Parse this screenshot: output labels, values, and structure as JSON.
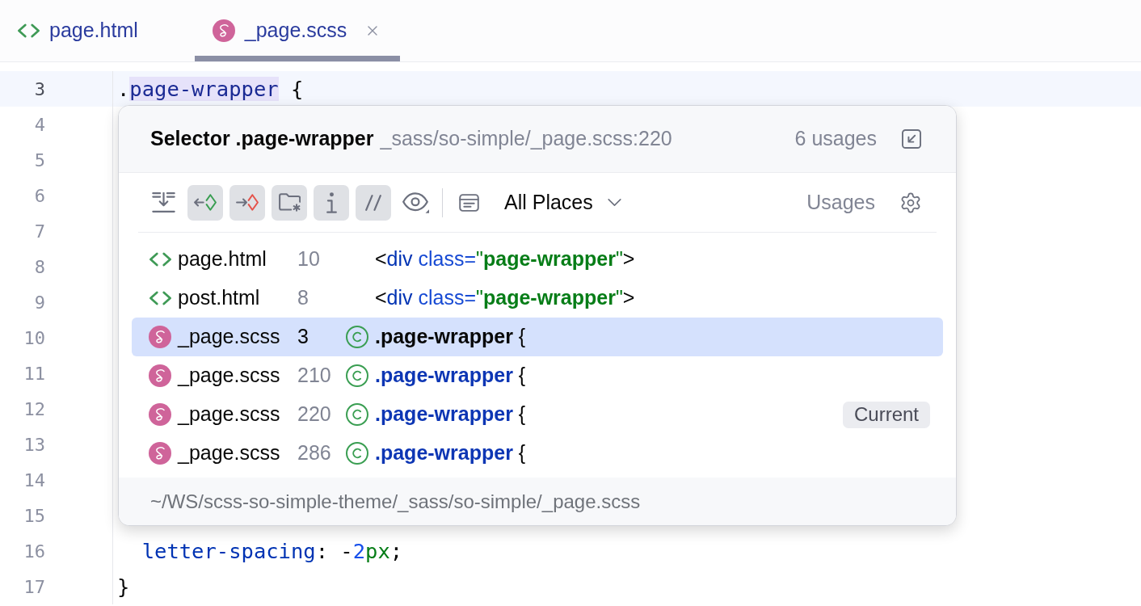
{
  "tabs": [
    {
      "label": "page.html",
      "kind": "html",
      "selected": false,
      "closable": false
    },
    {
      "label": "_page.scss",
      "kind": "scss",
      "selected": true,
      "closable": true
    }
  ],
  "editor": {
    "lines": [
      {
        "number": "3",
        "current": true,
        "tokens": [
          {
            "text": ".",
            "kind": "plain",
            "highlighted": false
          },
          {
            "text": "page-wrapper",
            "kind": "selector",
            "highlighted": true
          },
          {
            "text": " {",
            "kind": "plain",
            "highlighted": false
          }
        ]
      },
      {
        "number": "4",
        "current": false
      },
      {
        "number": "5",
        "current": false
      },
      {
        "number": "6",
        "current": false
      },
      {
        "number": "7",
        "current": false
      },
      {
        "number": "8",
        "current": false
      },
      {
        "number": "9",
        "current": false
      },
      {
        "number": "10",
        "current": false
      },
      {
        "number": "11",
        "current": false
      },
      {
        "number": "12",
        "current": false
      },
      {
        "number": "13",
        "current": false
      },
      {
        "number": "14",
        "current": false
      },
      {
        "number": "15",
        "current": false
      },
      {
        "number": "16",
        "current": false,
        "tokens": [
          {
            "text": "  letter-spacing",
            "kind": "property",
            "highlighted": false
          },
          {
            "text": ": -",
            "kind": "plain",
            "highlighted": false
          },
          {
            "text": "2",
            "kind": "number",
            "highlighted": false
          },
          {
            "text": "px",
            "kind": "unit",
            "highlighted": false
          },
          {
            "text": ";",
            "kind": "plain",
            "highlighted": false
          }
        ]
      },
      {
        "number": "17",
        "current": false,
        "tokens": [
          {
            "text": "}",
            "kind": "plain",
            "highlighted": false
          }
        ]
      }
    ]
  },
  "usages_popup": {
    "title": "Selector .page-wrapper",
    "location": "_sass/so-simple/_page.scss:220",
    "count": "6 usages",
    "toolbar": {
      "toggles": [
        {
          "kind": "flatten",
          "on": false
        },
        {
          "kind": "read",
          "on": true
        },
        {
          "kind": "write",
          "on": true
        },
        {
          "kind": "module",
          "on": true
        },
        {
          "kind": "info",
          "on": true
        },
        {
          "kind": "comment",
          "on": true
        },
        {
          "kind": "preview",
          "on": false
        }
      ],
      "scope": "All Places",
      "group": "Usages"
    },
    "rows": [
      {
        "kind": "html",
        "file": "page.html",
        "line": "10",
        "selected": false,
        "tokens": [
          {
            "text": "<",
            "kind": "plain",
            "matched": false
          },
          {
            "text": "div",
            "kind": "tag",
            "matched": false
          },
          {
            "text": " class=",
            "kind": "attribute",
            "matched": false
          },
          {
            "text": "\"",
            "kind": "string",
            "matched": false
          },
          {
            "text": "page-wrapper",
            "kind": "string",
            "matched": true
          },
          {
            "text": "\"",
            "kind": "string",
            "matched": false
          },
          {
            "text": ">",
            "kind": "plain",
            "matched": false
          }
        ]
      },
      {
        "kind": "html",
        "file": "post.html",
        "line": "8",
        "selected": false,
        "tokens": [
          {
            "text": "<",
            "kind": "plain",
            "matched": false
          },
          {
            "text": "div",
            "kind": "tag",
            "matched": false
          },
          {
            "text": " class=",
            "kind": "attribute",
            "matched": false
          },
          {
            "text": "\"",
            "kind": "string",
            "matched": false
          },
          {
            "text": "page-wrapper",
            "kind": "string",
            "matched": true
          },
          {
            "text": "\"",
            "kind": "string",
            "matched": false
          },
          {
            "text": ">",
            "kind": "plain",
            "matched": false
          }
        ]
      },
      {
        "kind": "scss",
        "file": "_page.scss",
        "line": "3",
        "selected": true,
        "tokens": [
          {
            "text": ".page-wrapper",
            "kind": "plain",
            "matched": true
          },
          {
            "text": " {",
            "kind": "plain",
            "matched": false
          }
        ]
      },
      {
        "kind": "scss",
        "file": "_page.scss",
        "line": "210",
        "selected": false,
        "tokens": [
          {
            "text": ".page-wrapper",
            "kind": "selector",
            "matched": true
          },
          {
            "text": " {",
            "kind": "plain",
            "matched": false
          }
        ]
      },
      {
        "kind": "scss",
        "file": "_page.scss",
        "line": "220",
        "selected": false,
        "badge": "Current",
        "tokens": [
          {
            "text": ".page-wrapper",
            "kind": "selector",
            "matched": true
          },
          {
            "text": " {",
            "kind": "plain",
            "matched": false
          }
        ]
      },
      {
        "kind": "scss",
        "file": "_page.scss",
        "line": "286",
        "selected": false,
        "tokens": [
          {
            "text": ".page-wrapper",
            "kind": "selector",
            "matched": true
          },
          {
            "text": " {",
            "kind": "plain",
            "matched": false
          }
        ]
      }
    ],
    "footer_path": "~/WS/scss-so-simple-theme/_sass/so-simple/_page.scss"
  }
}
